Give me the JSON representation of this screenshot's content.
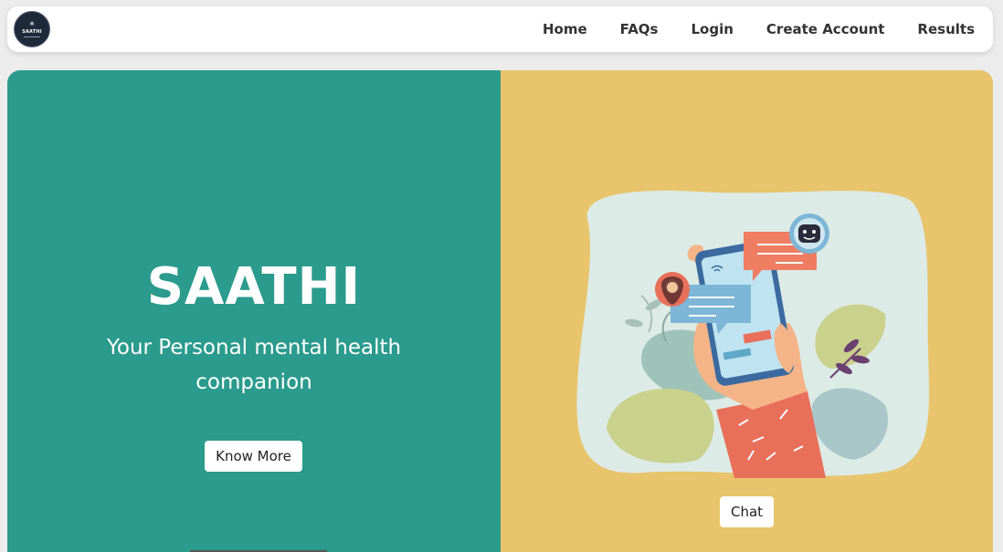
{
  "nav": {
    "logo_text": "SAATHI",
    "links": [
      "Home",
      "FAQs",
      "Login",
      "Create Account",
      "Results"
    ]
  },
  "hero": {
    "title": "SAATHI",
    "subtitle": "Your Personal mental health companion",
    "know_more_label": "Know More",
    "chat_label": "Chat"
  },
  "colors": {
    "teal": "#2a9b8c",
    "yellow": "#e8c46c",
    "navbar_bg": "#ffffff",
    "page_bg": "#ececec"
  }
}
